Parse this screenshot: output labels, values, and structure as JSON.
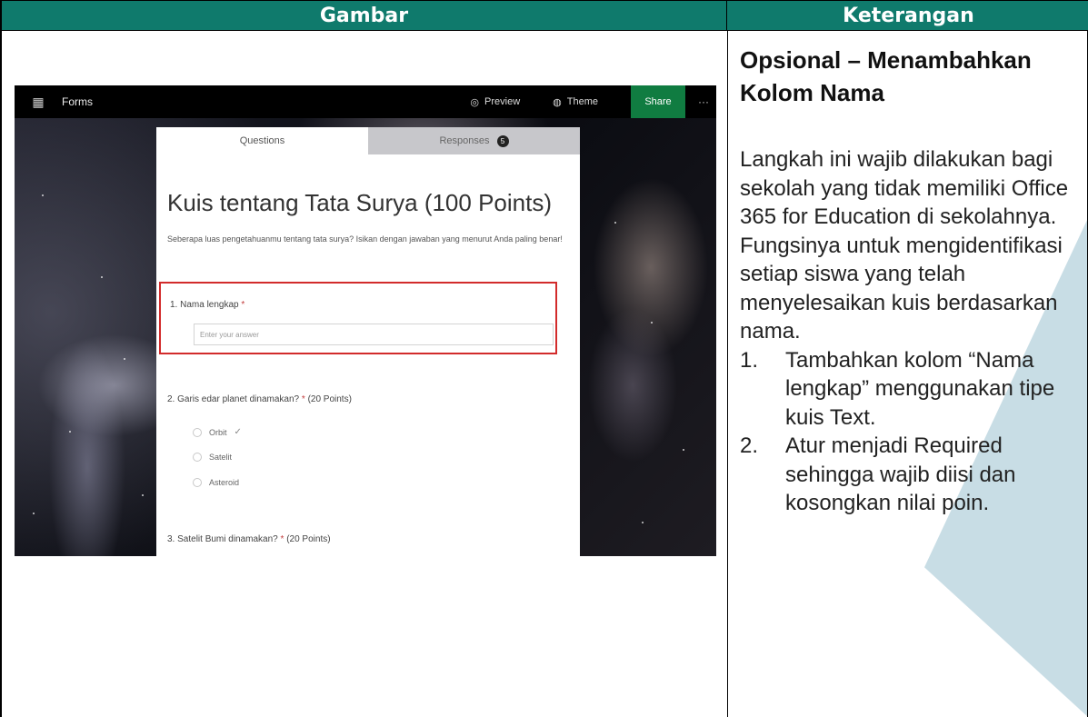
{
  "headers": {
    "left": "Gambar",
    "right": "Keterangan"
  },
  "screenshot": {
    "app_name": "Forms",
    "topbar": {
      "preview": "Preview",
      "theme": "Theme",
      "share": "Share",
      "more": "···"
    },
    "tabs": {
      "questions": "Questions",
      "responses": "Responses",
      "responses_count": "5"
    },
    "form": {
      "title": "Kuis tentang Tata Surya (100 Points)",
      "description": "Seberapa luas pengetahuanmu tentang tata surya? Isikan dengan jawaban yang menurut Anda paling benar!",
      "q1": {
        "label": "1. Nama lengkap",
        "required_mark": "*",
        "placeholder": "Enter your answer"
      },
      "q2": {
        "label": "2. Garis edar planet dinamakan?",
        "required_mark": "*",
        "points": "(20 Points)",
        "options": [
          "Orbit",
          "Satelit",
          "Asteroid"
        ],
        "correct_mark": "✓"
      },
      "q3": {
        "label": "3. Satelit Bumi dinamakan?",
        "required_mark": "*",
        "points": "(20 Points)"
      }
    }
  },
  "description": {
    "title": "Opsional – Menambahkan Kolom Nama",
    "body": "Langkah ini wajib dilakukan bagi sekolah yang tidak memiliki Office 365 for Education di sekolahnya. Fungsinya untuk mengidentifikasi setiap siswa yang telah menyelesaikan kuis berdasarkan nama.",
    "steps": [
      {
        "num": "1.",
        "text": "Tambahkan kolom “Nama lengkap” menggunakan tipe kuis Text."
      },
      {
        "num": "2.",
        "text": "Atur menjadi Required sehingga wajib diisi dan kosongkan nilai poin."
      }
    ]
  },
  "colors": {
    "header_bg": "#0f7a6c",
    "share_button": "#107c41",
    "highlight_border": "#d22b2b",
    "decor": "#c8dde5"
  }
}
